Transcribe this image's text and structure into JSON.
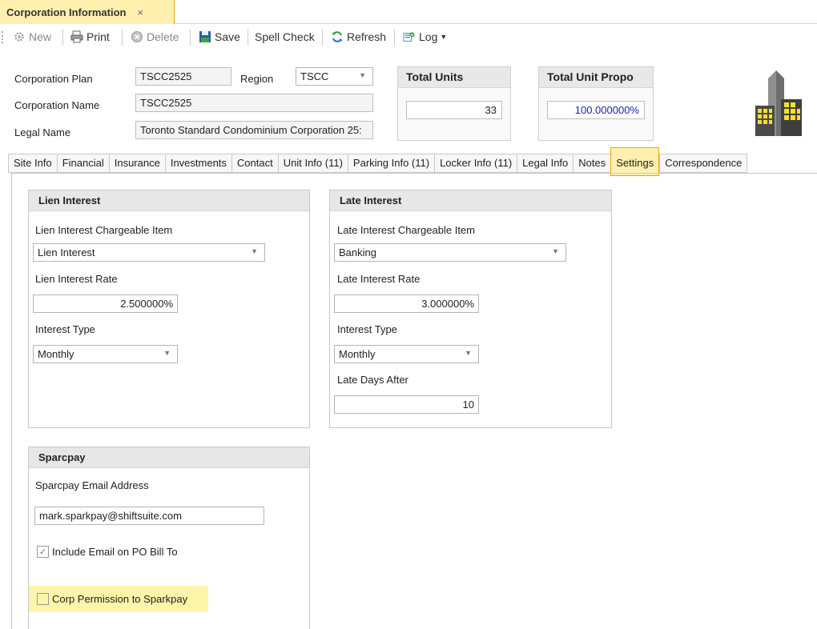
{
  "doc_tab": {
    "title": "Corporation Information",
    "close": "×"
  },
  "toolbar": {
    "new": "New",
    "print": "Print",
    "delete": "Delete",
    "save": "Save",
    "spell_check": "Spell Check",
    "refresh": "Refresh",
    "log": "Log"
  },
  "header": {
    "plan_label": "Corporation Plan",
    "plan_value": "TSCC2525",
    "region_label": "Region",
    "region_value": "TSCC",
    "name_label": "Corporation Name",
    "name_value": "TSCC2525",
    "legal_label": "Legal Name",
    "legal_value": "Toronto Standard Condominium Corporation 25:",
    "total_units_title": "Total Units",
    "total_units_value": "33",
    "total_prop_title": "Total Unit Propo",
    "total_prop_value": "100.000000%"
  },
  "tabs": [
    "Site Info",
    "Financial",
    "Insurance",
    "Investments",
    "Contact",
    "Unit Info (11)",
    "Parking Info (11)",
    "Locker Info (11)",
    "Legal Info",
    "Notes",
    "Settings",
    "Correspondence"
  ],
  "active_tab": "Settings",
  "lien": {
    "title": "Lien Interest",
    "item_label": "Lien Interest Chargeable Item",
    "item_value": "Lien Interest",
    "rate_label": "Lien Interest Rate",
    "rate_value": "2.500000%",
    "type_label": "Interest Type",
    "type_value": "Monthly"
  },
  "late": {
    "title": "Late Interest",
    "item_label": "Late Interest Chargeable Item",
    "item_value": "Banking",
    "rate_label": "Late Interest Rate",
    "rate_value": "3.000000%",
    "type_label": "Interest Type",
    "type_value": "Monthly",
    "days_label": "Late Days After",
    "days_value": "10"
  },
  "sparcpay": {
    "title": "Sparcpay",
    "email_label": "Sparcpay Email Address",
    "email_value": "mark.sparkpay@shiftsuite.com",
    "include_label": "Include Email on PO Bill To",
    "include_checked": true,
    "permission_label": "Corp Permission to Sparkpay",
    "permission_checked": false
  },
  "colors": {
    "highlight": "#fff0b0",
    "group_header": "#e7e7e7",
    "blue_value": "#1c1fa8"
  }
}
